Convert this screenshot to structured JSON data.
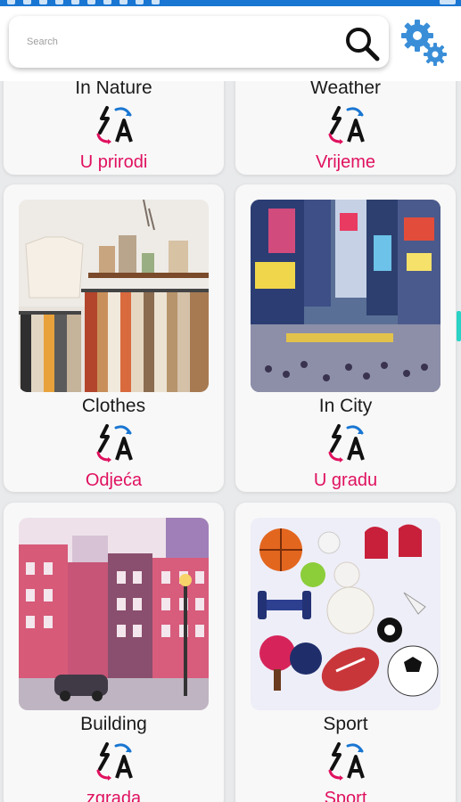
{
  "search": {
    "placeholder": "Search",
    "value": ""
  },
  "categories": [
    {
      "en": "In Nature",
      "hr": "U prirodi"
    },
    {
      "en": "Weather",
      "hr": "Vrijeme"
    },
    {
      "en": "Clothes",
      "hr": "Odjeća"
    },
    {
      "en": "In City",
      "hr": "U gradu"
    },
    {
      "en": "Building",
      "hr": "zgrada"
    },
    {
      "en": "Sport",
      "hr": "Sport"
    }
  ],
  "colors": {
    "statusbar": "#1976d2",
    "translation": "#e0115f",
    "gear": "#3a8ed8",
    "accent": "#2ad3c5"
  }
}
